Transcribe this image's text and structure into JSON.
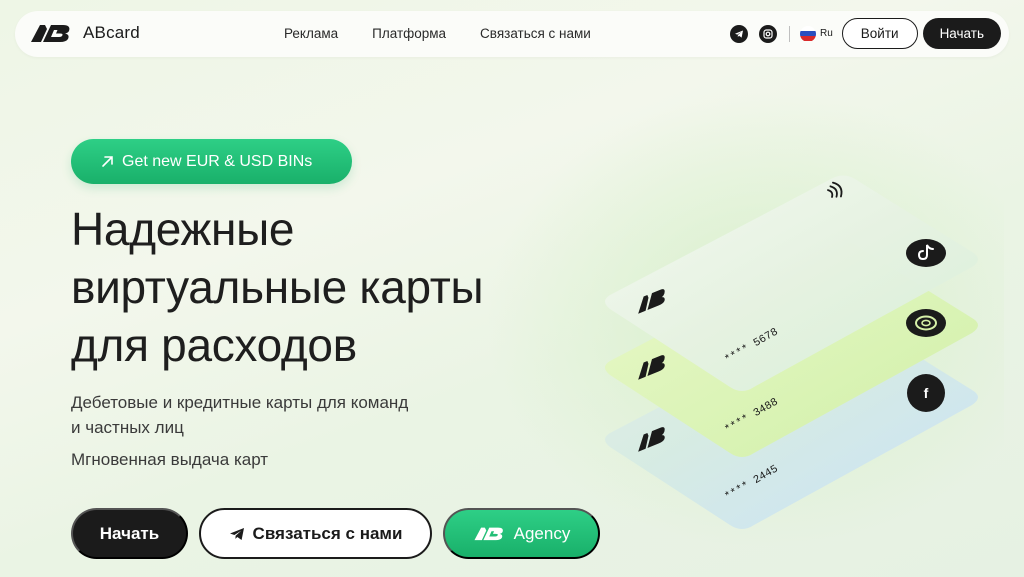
{
  "brand": {
    "name": "ABcard"
  },
  "nav": {
    "items": [
      "Реклама",
      "Платформа",
      "Связаться с нами"
    ]
  },
  "header": {
    "lang": "Ru",
    "login_label": "Войти",
    "start_label": "Начать"
  },
  "hero": {
    "badge_label": "Get new EUR & USD BINs",
    "title_lines": [
      "Надежные",
      "виртуальные карты",
      "для расходов"
    ],
    "subtitle_lines": [
      "Дебетовые и кредитные карты для команд",
      "и частных лиц"
    ],
    "subtitle2": "Мгновенная выдача карт",
    "cta_start": "Начать",
    "cta_contact": "Связаться с нами",
    "cta_agency": "Agency"
  },
  "cards": [
    {
      "number": "**** 5678",
      "service_icon": "tiktok-icon"
    },
    {
      "number": "**** 3488",
      "service_icon": "instagram-icon"
    },
    {
      "number": "**** 2445",
      "service_icon": "facebook-icon"
    }
  ],
  "colors": {
    "accent": "#1fbf75",
    "dark": "#1b1b1b",
    "bg": "#eef6e6"
  }
}
